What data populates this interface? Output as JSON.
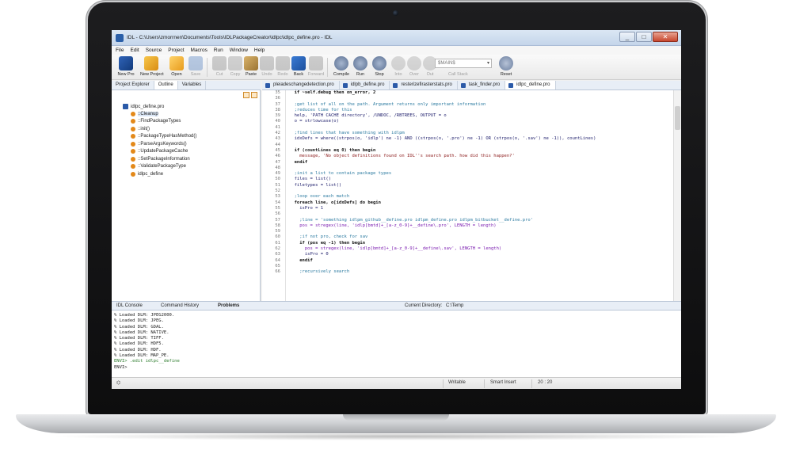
{
  "window": {
    "title": "IDL - C:\\Users\\zmorrnen\\Documents\\Tools\\IDLPackageCreator\\idlpc\\idlpc_define.pro - IDL",
    "controls": [
      "_",
      "□",
      "✕"
    ]
  },
  "menu": [
    "File",
    "Edit",
    "Source",
    "Project",
    "Macros",
    "Run",
    "Window",
    "Help"
  ],
  "toolbar": {
    "buttons": [
      {
        "label": "New Pro",
        "icon": "new-pro-icon",
        "enabled": true
      },
      {
        "label": "New Project",
        "icon": "new-project-icon",
        "enabled": true
      },
      {
        "label": "Open",
        "icon": "open-folder-icon",
        "enabled": true
      },
      {
        "label": "Save",
        "icon": "save-icon",
        "enabled": false
      },
      {
        "label": "Cut",
        "icon": "scissors-icon",
        "enabled": false
      },
      {
        "label": "Copy",
        "icon": "copy-icon",
        "enabled": false
      },
      {
        "label": "Paste",
        "icon": "paste-icon",
        "enabled": true
      },
      {
        "label": "Undo",
        "icon": "undo-icon",
        "enabled": false
      },
      {
        "label": "Redo",
        "icon": "redo-icon",
        "enabled": false
      },
      {
        "label": "Back",
        "icon": "back-arrow-icon",
        "enabled": true
      },
      {
        "label": "Forward",
        "icon": "forward-arrow-icon",
        "enabled": false
      },
      {
        "label": "Compile",
        "icon": "compile-icon",
        "enabled": true
      },
      {
        "label": "Run",
        "icon": "run-icon",
        "enabled": true
      },
      {
        "label": "Stop",
        "icon": "stop-icon",
        "enabled": true
      },
      {
        "label": "Into",
        "icon": "step-into-icon",
        "enabled": false
      },
      {
        "label": "Over",
        "icon": "step-over-icon",
        "enabled": false
      },
      {
        "label": "Out",
        "icon": "step-out-icon",
        "enabled": false
      },
      {
        "label": "Reset",
        "icon": "reset-icon",
        "enabled": true
      }
    ],
    "call_stack_value": "$MAIN$",
    "call_stack_label": "Call Stack"
  },
  "left_tabs": [
    "Project Explorer",
    "Outline",
    "Variables"
  ],
  "outline": {
    "root": "idlpc_define.pro",
    "items": [
      "::Cleanup",
      "::FindPackageTypes",
      "::init()",
      "::PackageTypeHasMethod()",
      "::ParseArgsKeywords()",
      "::UpdatePackageCache",
      "::SetPackageInformation",
      "::ValidatePackageType",
      "idlpc_define"
    ]
  },
  "editor_tabs": [
    "pleiadeschangedetection.pro",
    "idlpb_define.pro",
    "resterizefirasterstats.pro",
    "task_finder.pro",
    "idlpc_define.pro"
  ],
  "code": [
    {
      "n": "35",
      "t": "  if ~self.debug then on_error, 2",
      "c": "kw"
    },
    {
      "n": "36",
      "t": "",
      "c": ""
    },
    {
      "n": "37",
      "t": "  ;get list of all on the path. Argument returns only important information",
      "c": "comment"
    },
    {
      "n": "38",
      "t": "  ;reduces time for this",
      "c": "comment"
    },
    {
      "n": "39",
      "t": "  help, 'PATH CACHE directory', /UNDOC, /RBTREES, OUTPUT = o",
      "c": ""
    },
    {
      "n": "40",
      "t": "  o = strlowcase(o)",
      "c": ""
    },
    {
      "n": "41",
      "t": "",
      "c": ""
    },
    {
      "n": "42",
      "t": "  ;find lines that have something with idlpm",
      "c": "comment"
    },
    {
      "n": "43",
      "t": "  idxDefs = where((strpos(o, 'idlp') ne -1) AND ((strpos(o, '.pro') ne -1) OR (strpos(o, '.sav') ne -1)), countLines)",
      "c": ""
    },
    {
      "n": "44",
      "t": "",
      "c": ""
    },
    {
      "n": "45",
      "t": "  if (countLines eq 0) then begin",
      "c": "kw"
    },
    {
      "n": "46",
      "t": "    message, 'No object definitions found on IDL''s search path. how did this happen?'",
      "c": "accent"
    },
    {
      "n": "47",
      "t": "  endif",
      "c": "kw"
    },
    {
      "n": "48",
      "t": "",
      "c": ""
    },
    {
      "n": "49",
      "t": "  ;init a list to contain package types",
      "c": "comment"
    },
    {
      "n": "50",
      "t": "  files = list()",
      "c": ""
    },
    {
      "n": "51",
      "t": "  filetypes = list()",
      "c": ""
    },
    {
      "n": "52",
      "t": "",
      "c": ""
    },
    {
      "n": "53",
      "t": "  ;loop over each match",
      "c": "comment"
    },
    {
      "n": "54",
      "t": "  foreach line, o[idxDefs] do begin",
      "c": "kw"
    },
    {
      "n": "55",
      "t": "    isPro = 1",
      "c": ""
    },
    {
      "n": "56",
      "t": "",
      "c": ""
    },
    {
      "n": "57",
      "t": "    ;line = 'something idlpm_github__define.pro idlpm_define.pro idlpm_bitbucket__define.pro'",
      "c": "comment"
    },
    {
      "n": "58",
      "t": "    pos = stregex(line, 'idlp[bmtd]+_[a-z_0-9]+__define\\.pro', LENGTH = length)",
      "c": "string"
    },
    {
      "n": "59",
      "t": "",
      "c": ""
    },
    {
      "n": "60",
      "t": "    ;if not pro, check for sav",
      "c": "comment"
    },
    {
      "n": "61",
      "t": "    if (pos eq -1) then begin",
      "c": "kw"
    },
    {
      "n": "62",
      "t": "      pos = stregex(line, 'idlp[bmtd]+_[a-z_0-9]+__define\\.sav', LENGTH = length)",
      "c": "string"
    },
    {
      "n": "63",
      "t": "      isPro = 0",
      "c": ""
    },
    {
      "n": "64",
      "t": "    endif",
      "c": "kw"
    },
    {
      "n": "65",
      "t": "",
      "c": ""
    },
    {
      "n": "66",
      "t": "    ;recursively search",
      "c": "comment"
    }
  ],
  "console_tabs": [
    "IDL Console",
    "Command History",
    "Problems"
  ],
  "current_directory_label": "Current Directory:",
  "current_directory": "C:\\Temp",
  "console_lines": [
    "% Loaded DLM: JPEG2000.",
    "% Loaded DLM: JPEG.",
    "% Loaded DLM: GDAL.",
    "% Loaded DLM: NATIVE.",
    "% Loaded DLM: TIFF.",
    "% Loaded DLM: HDF5.",
    "% Loaded DLM: HDF.",
    "% Loaded DLM: MAP_PE."
  ],
  "console_cmd_prompt": "ENVI> .edit idlpc__define",
  "console_prompt": "ENVI>",
  "status": {
    "mode": "Writable",
    "insert": "Smart Insert",
    "position": "20 : 20"
  }
}
